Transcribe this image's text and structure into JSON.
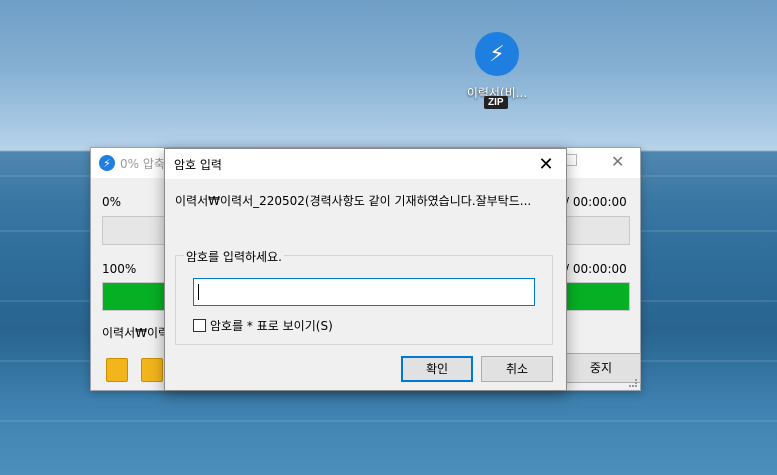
{
  "desktop": {
    "icon_name": "이력서(비...",
    "icon_badge": "ZIP"
  },
  "compress_window": {
    "title": "0% 압축",
    "progress_file_pct": "0%",
    "progress_file_time": "/ 00:00:00",
    "progress_file_fraction": 0,
    "progress_total_pct": "100%",
    "progress_total_time": "/ 00:00:00",
    "progress_total_fraction": 1.0,
    "current_file": "이력서₩이력",
    "stop_label": "중지",
    "progress_color": "#06b025"
  },
  "password_dialog": {
    "title": "암호 입력",
    "file_path": "이력서₩이력서_220502(경력사항도 같이 기재하였습니다.잘부탁드...",
    "group_label": "암호를 입력하세요.",
    "password_value": "",
    "show_password_label": "암호를 * 표로 보이기(S)",
    "show_password_checked": false,
    "ok_label": "확인",
    "cancel_label": "취소",
    "close_glyph": "✕"
  },
  "colors": {
    "accent": "#0078d7",
    "app_icon": "#1f7fe0"
  }
}
